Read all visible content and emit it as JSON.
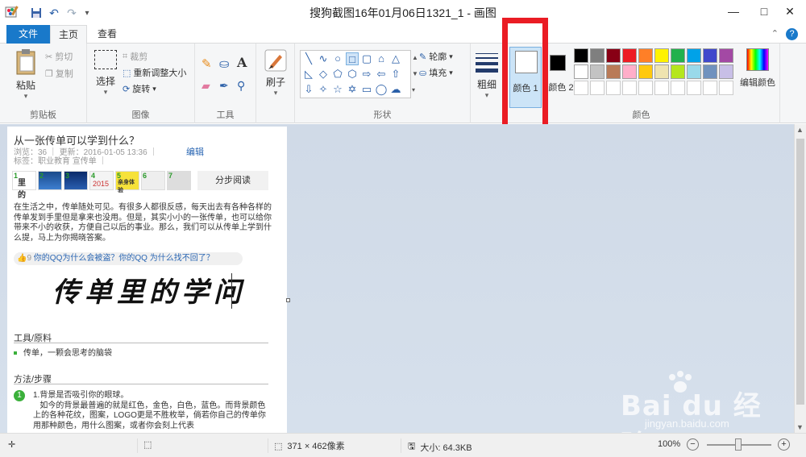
{
  "window": {
    "title": "搜狗截图16年01月06日1321_1 - 画图",
    "minimize": "—",
    "maximize": "□",
    "close": "✕"
  },
  "tabs": {
    "file": "文件",
    "home": "主页",
    "view": "查看",
    "help": "?"
  },
  "ribbon": {
    "clipboard": {
      "label": "剪贴板",
      "paste": "粘贴",
      "cut": "剪切",
      "copy": "复制"
    },
    "image": {
      "label": "图像",
      "select": "选择",
      "crop": "裁剪",
      "resize": "重新调整大小",
      "rotate": "旋转"
    },
    "tools": {
      "label": "工具"
    },
    "brushes": {
      "label": "刷子"
    },
    "shapes": {
      "label": "形状",
      "outline": "轮廓",
      "fill": "填充"
    },
    "size": {
      "label": "粗细"
    },
    "colors": {
      "label": "颜色",
      "color1": "颜色 1",
      "color2": "颜色 2",
      "edit": "编辑颜色",
      "palette_row1": [
        "#000000",
        "#7f7f7f",
        "#880015",
        "#ed1c24",
        "#ff7f27",
        "#fff200",
        "#22b14c",
        "#00a2e8",
        "#3f48cc",
        "#a349a4"
      ],
      "palette_row2": [
        "#ffffff",
        "#c3c3c3",
        "#b97a57",
        "#ffaec9",
        "#ffc90e",
        "#efe4b0",
        "#b5e61d",
        "#99d9ea",
        "#7092be",
        "#c8bfe7"
      ]
    }
  },
  "doc": {
    "title": "从一张传单可以学到什么？",
    "meta": "浏览：36 ｜ 更新：2016-01-05 13:36 ｜",
    "edit": "编辑",
    "tags": "标签：职业教育 宣传单 ｜",
    "thumbs": [
      "1",
      "2",
      "3",
      "4",
      "5",
      "6",
      "7"
    ],
    "thumb_text": [
      "里 的",
      "",
      "",
      "2015",
      "亲身体验",
      "",
      ""
    ],
    "step_read": "分步阅读",
    "intro": "在生活之中，传单随处可见。有很多人都很反感，每天出去有各种各样的传单发到手里但是拿来也没用。但是，其实小小的一张传单，也可以给你带来不小的收获，方便自己以后的事业。那么，我们可以从传单上学到什么提，马上为你揭晓答案。",
    "qq_count": "9",
    "qq_link": "你的QQ为什么会被盗？你的QQ 为什么找不回了？",
    "calligraphy": "传单里的学问",
    "tools_heading": "工具/原料",
    "tools_item": "传单，一颗会思考的脑袋",
    "method_heading": "方法/步骤",
    "step1_no": "1",
    "step1_text": "1.背景是否吸引你的眼球。\n   如今的背景最普遍的就是红色，金色，白色，蓝色。而背景颜色上的各种花纹，图案，LOGO更是不胜枚举，倘若你自己的传单你用那种颜色，用什么图案，或者你会刻上代表"
  },
  "watermark": {
    "logo": "Bai du 经验",
    "url": "jingyan.baidu.com"
  },
  "status": {
    "dimensions": "371 × 462像素",
    "size": "大小: 64.3KB",
    "zoom": "100%"
  }
}
